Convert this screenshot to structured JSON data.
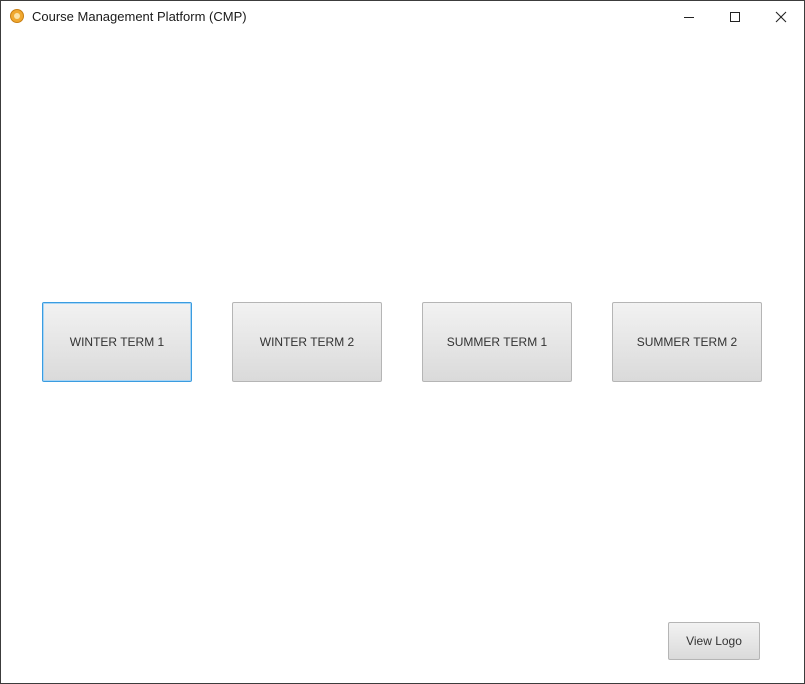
{
  "window": {
    "title": "Course Management Platform (CMP)",
    "app_icon": "cmp-logo-icon",
    "controls": {
      "minimize_icon": "minimize-icon",
      "maximize_icon": "maximize-icon",
      "close_icon": "close-icon"
    }
  },
  "terms": {
    "winter_term_1": "WINTER TERM 1",
    "winter_term_2": "WINTER TERM 2",
    "summer_term_1": "SUMMER TERM 1",
    "summer_term_2": "SUMMER TERM 2",
    "focused": "WINTER TERM 1"
  },
  "footer": {
    "view_logo_label": "View Logo"
  },
  "colors": {
    "focus_border": "#3a9ce0",
    "button_top": "#f2f2f2",
    "button_bottom": "#dadada",
    "app_icon": "#f0a830"
  }
}
